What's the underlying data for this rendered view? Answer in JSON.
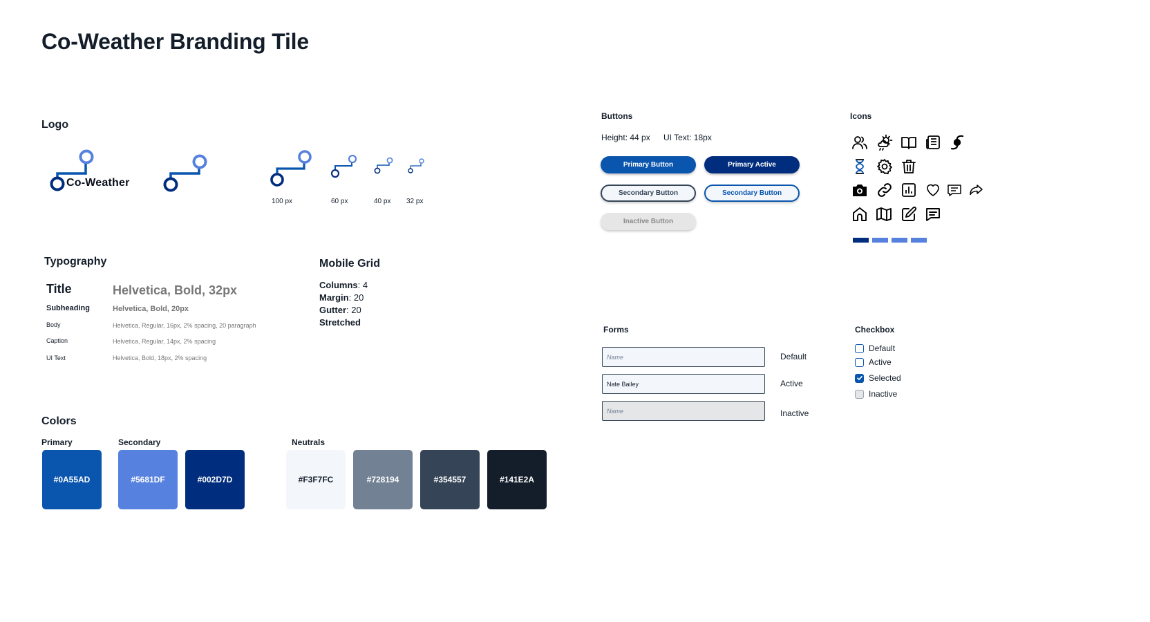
{
  "page": {
    "title": "Co-Weather Branding Tile"
  },
  "logo": {
    "heading": "Logo",
    "wordmark": "Co-Weather",
    "sizes": [
      "100 px",
      "60 px",
      "40 px",
      "32 px"
    ]
  },
  "typography": {
    "heading": "Typography",
    "rows": [
      {
        "name": "Title",
        "spec": "Helvetica, Bold, 32px"
      },
      {
        "name": "Subheading",
        "spec": "Helvetica, Bold, 20px"
      },
      {
        "name": "Body",
        "spec": "Helvetica, Regular, 16px, 2% spacing, 20 paragraph"
      },
      {
        "name": "Caption",
        "spec": "Helvetica, Regular, 14px, 2% spacing"
      },
      {
        "name": "UI Text",
        "spec": "Helvetica, Bold, 18px, 2% spacing"
      }
    ]
  },
  "mobile_grid": {
    "heading": "Mobile Grid",
    "columns_label": "Columns",
    "columns_value": ": 4",
    "margin_label": "Margin",
    "margin_value": ": 20",
    "gutter_label": "Gutter",
    "gutter_value": ": 20",
    "stretched": "Stretched"
  },
  "colors": {
    "heading": "Colors",
    "primary_label": "Primary",
    "secondary_label": "Secondary",
    "neutrals_label": "Neutrals",
    "primary": [
      {
        "hex": "#0A55AD",
        "text_color": "#ffffff"
      }
    ],
    "secondary": [
      {
        "hex": "#5681DF",
        "text_color": "#ffffff"
      },
      {
        "hex": "#002D7D",
        "text_color": "#ffffff"
      }
    ],
    "neutrals": [
      {
        "hex": "#F3F7FC",
        "text_color": "#141E2A"
      },
      {
        "hex": "#728194",
        "text_color": "#ffffff"
      },
      {
        "hex": "#354557",
        "text_color": "#ffffff"
      },
      {
        "hex": "#141E2A",
        "text_color": "#ffffff"
      }
    ]
  },
  "buttons": {
    "heading": "Buttons",
    "height_spec": "Height: 44 px",
    "ui_text_spec": "UI Text: 18px",
    "primary": "Primary Button",
    "primary_active": "Primary Active",
    "secondary": "Secondary Button",
    "secondary_active": "Secondary Button",
    "inactive": "Inactive Button"
  },
  "icons": {
    "heading": "Icons",
    "names": [
      "users-icon",
      "weather-icon",
      "book-icon",
      "news-icon",
      "hurricane-icon",
      "hourglass-icon",
      "settings-icon",
      "trash-icon",
      "camera-icon",
      "link-icon",
      "chart-icon",
      "heart-icon",
      "comment-icon",
      "share-icon",
      "home-icon",
      "map-icon",
      "edit-icon",
      "message-icon"
    ],
    "bar_colors": [
      "#002D7D",
      "#5681DF",
      "#5681DF",
      "#5681DF"
    ]
  },
  "forms": {
    "heading": "Forms",
    "default_placeholder": "Name",
    "active_value": "Nate Bailey",
    "inactive_placeholder": "Name",
    "state_default": "Default",
    "state_active": "Active",
    "state_inactive": "Inactive"
  },
  "checkbox": {
    "heading": "Checkbox",
    "default": "Default",
    "active": "Active",
    "selected": "Selected",
    "inactive": "Inactive"
  }
}
